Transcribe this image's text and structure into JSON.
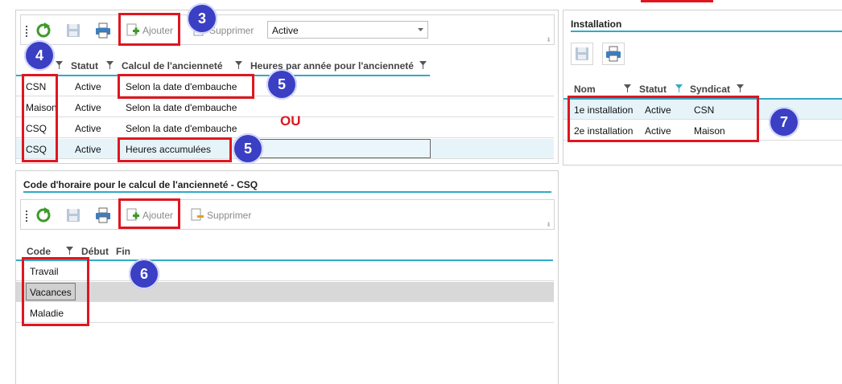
{
  "main_toolbar": {
    "add_label": "Ajouter",
    "delete_label": "Supprimer",
    "status_select_value": "Active"
  },
  "main_grid": {
    "headers": [
      "Statut",
      "Calcul de l'ancienneté",
      "Heures par année pour l'ancienneté"
    ],
    "rows": [
      {
        "union": "CSN",
        "status": "Active",
        "calc": "Selon la date d'embauche"
      },
      {
        "union": "Maison",
        "status": "Active",
        "calc": "Selon la date d'embauche"
      },
      {
        "union": "CSQ",
        "status": "Active",
        "calc": "Selon la date d'embauche"
      },
      {
        "union": "CSQ",
        "status": "Active",
        "calc": "Heures accumulées"
      }
    ]
  },
  "annotations": {
    "badge3": "3",
    "badge4": "4",
    "badge5a": "5",
    "badge5b": "5",
    "badge6": "6",
    "badge7": "7",
    "or_text": "OU"
  },
  "schedule_panel": {
    "title": "Code d'horaire pour le calcul de l'ancienneté - CSQ",
    "add_label": "Ajouter",
    "delete_label": "Supprimer",
    "headers": [
      "Code",
      "Début",
      "Fin"
    ],
    "rows": [
      "Travail",
      "Vacances",
      "Maladie"
    ]
  },
  "installation_panel": {
    "title": "Installation",
    "headers": [
      "Nom",
      "Statut",
      "Syndicat"
    ],
    "rows": [
      {
        "name": "1e installation",
        "status": "Active",
        "union": "CSN"
      },
      {
        "name": "2e installation",
        "status": "Active",
        "union": "Maison"
      }
    ]
  },
  "colors": {
    "accent_teal": "#33a9c7",
    "annotation_red": "#e0161f",
    "badge_blue": "#3a3fc4",
    "selected_row": "#e6f4fa",
    "gray_row": "#d8d8d8"
  },
  "icons": [
    "refresh-icon",
    "save-icon",
    "print-icon",
    "add-icon",
    "delete-icon",
    "filter-icon",
    "dropdown-arrow-icon"
  ]
}
